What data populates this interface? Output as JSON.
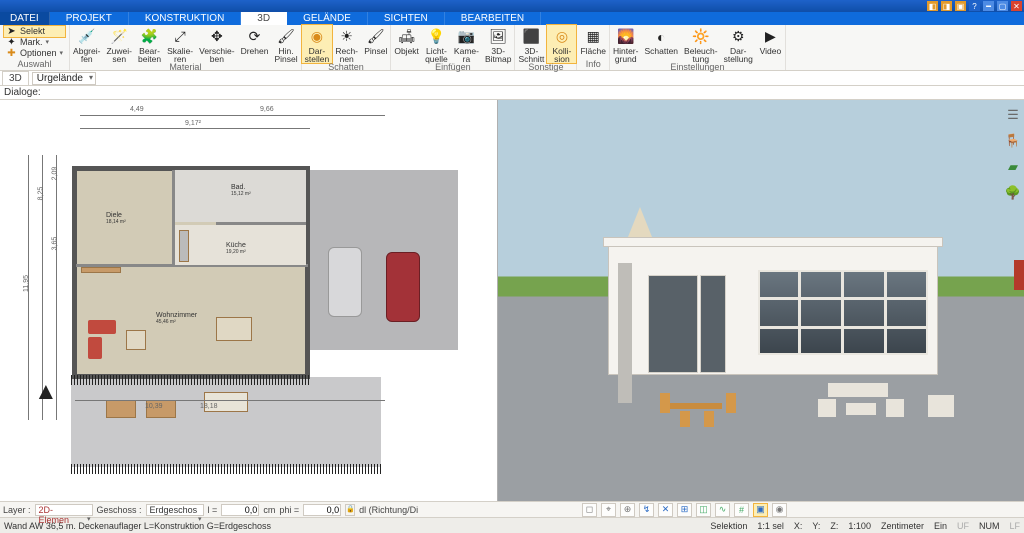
{
  "menu": {
    "datei": "DATEI",
    "projekt": "PROJEKT",
    "konstruktion": "KONSTRUKTION",
    "d3": "3D",
    "gelaende": "GELÄNDE",
    "sichten": "SICHTEN",
    "bearbeiten": "BEARBEITEN"
  },
  "ribbon": {
    "auswahl": {
      "selekt": "Selekt",
      "mark": "Mark.",
      "optionen": "Optionen",
      "group": "Auswahl"
    },
    "material": {
      "abgreifen": "Abgrei-\nfen",
      "zuweisen": "Zuwei-\nsen",
      "bearbeiten": "Bear-\nbeiten",
      "skalieren": "Skalie-\nren",
      "verschieben": "Verschie-\nben",
      "drehen": "Drehen",
      "hin_pinsel": "Hin.\nPinsel",
      "group": "Material"
    },
    "schatten": {
      "darstellen": "Dar-\nstellen",
      "rechnen": "Rech-\nnen",
      "pinsel": "Pinsel",
      "group": "Schatten"
    },
    "einfuegen": {
      "objekt": "Objekt",
      "lichtquelle": "Licht-\nquelle",
      "kamera": "Kame-\nra",
      "bitmap3d": "3D-\nBitmap",
      "group": "Einfügen"
    },
    "sonstige": {
      "schnitt3d": "3D-\nSchnitt",
      "kollision": "Kolli-\nsion",
      "group": "Sonstige"
    },
    "info": {
      "flaeche": "Fläche",
      "group": "Info"
    },
    "einstellungen": {
      "hintergrund": "Hinter-\ngrund",
      "schatten": "Schatten",
      "beleuchtung": "Beleuch-\ntung",
      "darstellung": "Dar-\nstellung",
      "video": "Video",
      "group": "Einstellungen"
    }
  },
  "subbar": {
    "tab": "3D",
    "combo": "Urgelände"
  },
  "dialoge": "Dialoge:",
  "plan": {
    "rooms": {
      "bad": "Bad.",
      "bad_area": "15,12 m²",
      "diele": "Diele",
      "diele_area": "18,14 m²",
      "kueche": "Küche",
      "kueche_area": "19,20 m²",
      "wohn": "Wohnzimmer",
      "wohn_area": "45,46 m²"
    },
    "dims": {
      "top1": "4,49",
      "top2": "9,66",
      "top3": "9,17²",
      "leftH": "11,95",
      "left1": "8,25",
      "left2": "2,09",
      "left3": "3,65",
      "bot1": "10,39",
      "bot2": "18,18"
    }
  },
  "params": {
    "layer_lbl": "Layer :",
    "layer_val": "2D-Elemen",
    "geschoss_lbl": "Geschoss :",
    "geschoss_val": "Erdgeschos",
    "l_lbl": "l =",
    "l_val": "0,0",
    "l_unit": "cm",
    "phi_lbl": "phi =",
    "phi_val": "0,0",
    "dl_lbl": "dl (Richtung/Di"
  },
  "status": {
    "left": "Wand AW 36,5 m. Deckenauflager L=Konstruktion G=Erdgeschoss",
    "selektion": "Selektion",
    "sel": "1:1 sel",
    "x": "X:",
    "y": "Y:",
    "z": "Z:",
    "scale": "1:100",
    "unit": "Zentimeter",
    "ein": "Ein",
    "uf": "UF",
    "num": "NUM",
    "lf": "LF"
  }
}
